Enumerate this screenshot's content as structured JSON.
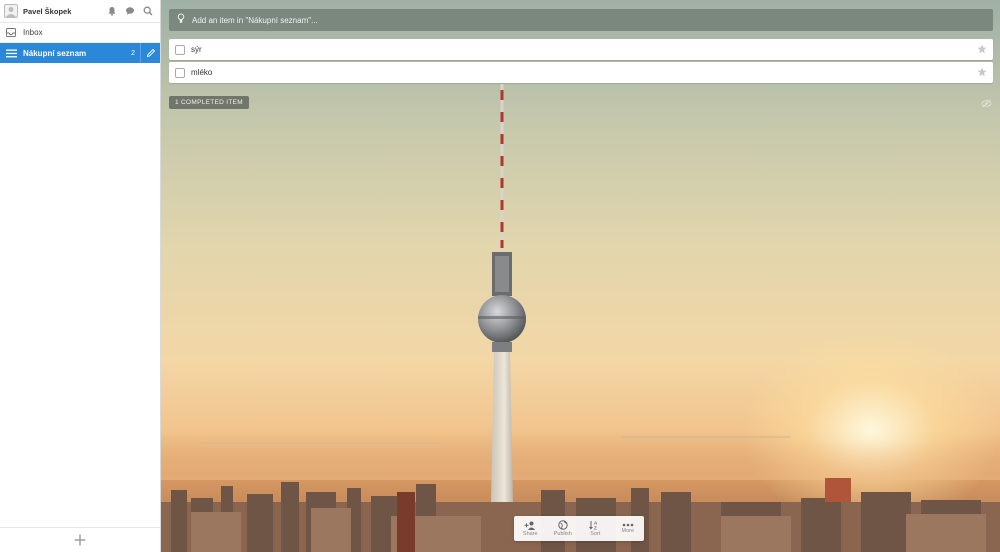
{
  "user": {
    "name": "Pavel Škopek"
  },
  "sidebar": {
    "header_icons": [
      "bell-icon",
      "comment-icon",
      "search-icon"
    ],
    "inbox": {
      "label": "Inbox",
      "icon": "inbox-icon"
    },
    "active_list": {
      "label": "Nákupní seznam",
      "count": "2",
      "icon": "list-icon"
    },
    "footer_icon": "plus-icon"
  },
  "main": {
    "add_placeholder": "Add an item in \"Nákupní seznam\"...",
    "tasks": [
      {
        "title": "sýr",
        "starred": false
      },
      {
        "title": "mléko",
        "starred": false
      }
    ],
    "completed_label": "1 COMPLETED ITEM"
  },
  "toolbar": {
    "share": "Share",
    "publish": "Publish",
    "sort": "Sort",
    "more": "More"
  },
  "colors": {
    "accent": "#2b88d9"
  }
}
